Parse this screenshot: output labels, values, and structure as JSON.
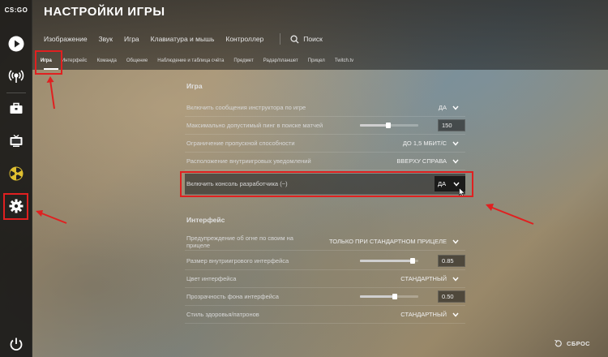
{
  "app": {
    "logo_text": "CS:GO"
  },
  "header": {
    "title": "НАСТРОЙКИ ИГРЫ",
    "main_tabs": [
      "Изображение",
      "Звук",
      "Игра",
      "Клавиатура и мышь",
      "Контроллер"
    ],
    "search_label": "Поиск",
    "sub_tabs": [
      "Игра",
      "Интерфейс",
      "Команда",
      "Общение",
      "Наблюдение и таблица счёта",
      "Предмет",
      "Радар/планшет",
      "Прицел",
      "Twitch.tv"
    ],
    "active_sub_tab": "Игра"
  },
  "sidebar": {
    "icons": [
      "play-icon",
      "broadcast-icon",
      "briefcase-icon",
      "tv-icon",
      "hazard-icon",
      "gear-icon",
      "power-icon"
    ]
  },
  "sections": {
    "game": {
      "title": "Игра",
      "rows": [
        {
          "label": "Включить сообщения инструктора по игре",
          "value": "ДА"
        },
        {
          "label": "Максимально допустимый пинг в поиске матчей",
          "value": "150",
          "slider_fraction": 0.48
        },
        {
          "label": "Ограничение пропускной способности",
          "value": "ДО 1,5 МБИТ/С"
        },
        {
          "label": "Расположение внутриигровых уведомлений",
          "value": "ВВЕРХУ СПРАВА"
        },
        {
          "label": "Включить консоль разработчика (~)",
          "value": "ДА"
        }
      ]
    },
    "interface": {
      "title": "Интерфейс",
      "rows": [
        {
          "label": "Предупреждение об огне по своим на прицеле",
          "value": "ТОЛЬКО ПРИ СТАНДАРТНОМ ПРИЦЕЛЕ"
        },
        {
          "label": "Размер внутриигрового интерфейса",
          "value": "0.85",
          "slider_fraction": 0.9
        },
        {
          "label": "Цвет интерфейса",
          "value": "СТАНДАРТНЫЙ"
        },
        {
          "label": "Прозрачность фона интерфейса",
          "value": "0.50",
          "slider_fraction": 0.6
        },
        {
          "label": "Стиль здоровья/патронов",
          "value": "СТАНДАРТНЫЙ"
        }
      ]
    }
  },
  "footer": {
    "reset_label": "СБРОС"
  },
  "colors": {
    "annotation_red": "#e02020",
    "text_primary": "#e8e8e8",
    "panel_dark": "#141414"
  }
}
